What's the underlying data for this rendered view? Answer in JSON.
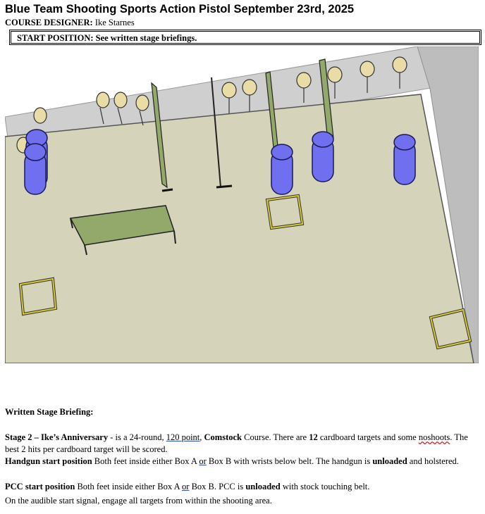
{
  "header": {
    "title": "Blue Team Shooting Sports Action Pistol September 23rd, 2025",
    "designer_label": "COURSE DESIGNER:",
    "designer_name": "Ike Starnes",
    "start_position": "START POSITION: See written stage briefings."
  },
  "briefing": {
    "heading": "Written Stage Briefing:",
    "stage_title": "Stage 2 – Ike’s Anniversary",
    "stage_desc_1": " - is a 24-round, ",
    "points": "120 point",
    "stage_desc_2": ", ",
    "course_type": "Comstock",
    "stage_desc_3": " Course. There are ",
    "target_count": "12",
    "stage_desc_4": " cardboard targets and some ",
    "noshoots": "noshoots",
    "scoring": ". The best 2 hits per cardboard target will be scored.",
    "handgun_label": "Handgun start position",
    "handgun_text_1": " Both feet inside either Box A ",
    "or_1": "or",
    "handgun_text_2": " Box B with wrists below belt. The handgun is ",
    "handgun_state": "unloaded",
    "handgun_text_3": " and holstered.",
    "pcc_label": "PCC start position",
    "pcc_text_1": " Both feet inside either Box A ",
    "or_2": "or",
    "pcc_text_2": " Box B. PCC is ",
    "pcc_state": "unloaded",
    "pcc_text_3": " with stock touching belt.",
    "start_signal": "On the audible start signal, engage all targets from within the shooting area."
  },
  "colors": {
    "floor": "#d5d3b9",
    "wall": "#c8c8c8",
    "barrel": "#6f6ff0",
    "target": "#e9dca6",
    "panel": "#93a86b",
    "box_outline": "#d8cc30"
  }
}
